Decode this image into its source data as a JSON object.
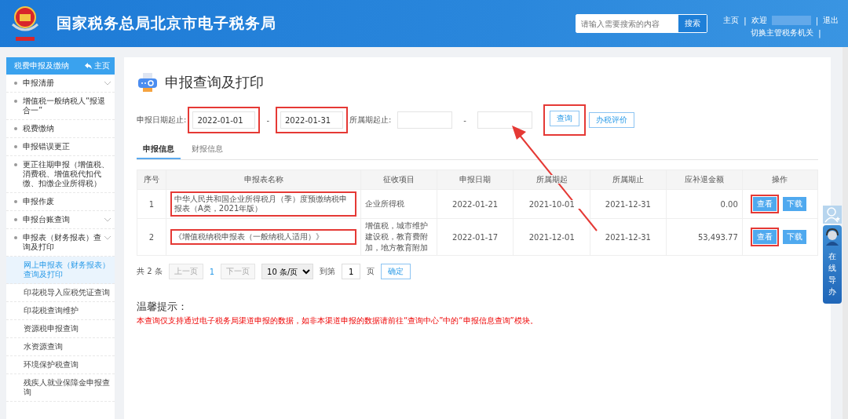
{
  "header": {
    "title": "国家税务总局北京市电子税务局",
    "search": {
      "placeholder": "请输入需要搜索的内容",
      "button": "搜索"
    },
    "separator": "|",
    "links_top": [
      "主页",
      "欢迎",
      "退出"
    ],
    "links_bottom": [
      "切换主管税务机关"
    ]
  },
  "sidebar": {
    "title": "税费申报及缴纳",
    "home": "主页",
    "items": [
      {
        "label": "申报清册",
        "kind": "group"
      },
      {
        "label": "增值税一般纳税人“报退合一”",
        "kind": "link"
      },
      {
        "label": "税费缴纳",
        "kind": "link"
      },
      {
        "label": "申报错误更正",
        "kind": "link"
      },
      {
        "label": "更正往期申报（增值税、消费税、增值税代扣代缴、扣缴企业所得税）",
        "kind": "link"
      },
      {
        "label": "申报作废",
        "kind": "link"
      },
      {
        "label": "申报台账查询",
        "kind": "group"
      },
      {
        "label": "申报表（财务报表）查询及打印",
        "kind": "group",
        "children": [
          {
            "label": "网上申报表（财务报表）查询及打印",
            "selected": true
          },
          {
            "label": "印花税导入应税凭证查询",
            "selected": false
          },
          {
            "label": "印花税查询维护",
            "selected": false
          },
          {
            "label": "资源税申报查询",
            "selected": false
          },
          {
            "label": "水资源查询",
            "selected": false
          },
          {
            "label": "环境保护税查询",
            "selected": false
          },
          {
            "label": "残疾人就业保障金申报查询",
            "selected": false
          }
        ]
      }
    ]
  },
  "page": {
    "title": "申报查询及打印",
    "filters": {
      "date_label": "申报日期起止:",
      "date_from": {
        "value": "2022-01-01",
        "highlighted": true
      },
      "date_to": {
        "value": "2022-01-31",
        "highlighted": true
      },
      "separator": "-",
      "period_label": "所属期起止:",
      "query_button": {
        "label": "查询",
        "highlighted": true
      },
      "rate_button": "办税评价"
    },
    "tabs": [
      {
        "label": "申报信息",
        "selected": true
      },
      {
        "label": "财报信息",
        "selected": false
      }
    ],
    "table": {
      "columns": [
        "序号",
        "申报表名称",
        "征收项目",
        "申报日期",
        "所属期起",
        "所属期止",
        "应补退金额",
        "操作"
      ],
      "rows": [
        {
          "no": "1",
          "name": "中华人民共和国企业所得税月（季）度预缴纳税申报表（A类，2021年版）",
          "name_highlighted": true,
          "item": "企业所得税",
          "date": "2022-01-21",
          "from": "2021-10-01",
          "to": "2021-12-31",
          "amount": "0.00",
          "actions": [
            {
              "label": "查看",
              "highlighted": true
            },
            {
              "label": "下载",
              "highlighted": false
            }
          ]
        },
        {
          "no": "2",
          "name": "《增值税纳税申报表（一般纳税人适用）》",
          "name_highlighted": true,
          "item": "增值税，城市维护建设税，教育费附加，地方教育附加",
          "date": "2022-01-17",
          "from": "2021-12-01",
          "to": "2021-12-31",
          "amount": "53,493.77",
          "actions": [
            {
              "label": "查看",
              "highlighted": true
            },
            {
              "label": "下载",
              "highlighted": false
            }
          ]
        }
      ]
    },
    "pagination": {
      "total": "共 2 条",
      "prev": "上一页",
      "current": "1",
      "next": "下一页",
      "page_size": "10 条/页",
      "goto_label": "到第",
      "goto_value": "1",
      "page_unit": "页",
      "confirm": "确定"
    },
    "tips": {
      "title": "温馨提示：",
      "text": "本查询仅支持通过电子税务局渠道申报的数据，如非本渠道申报的数据请前往“查询中心”中的“申报信息查询”模块。"
    }
  },
  "assistant": {
    "label": "在线导办"
  }
}
